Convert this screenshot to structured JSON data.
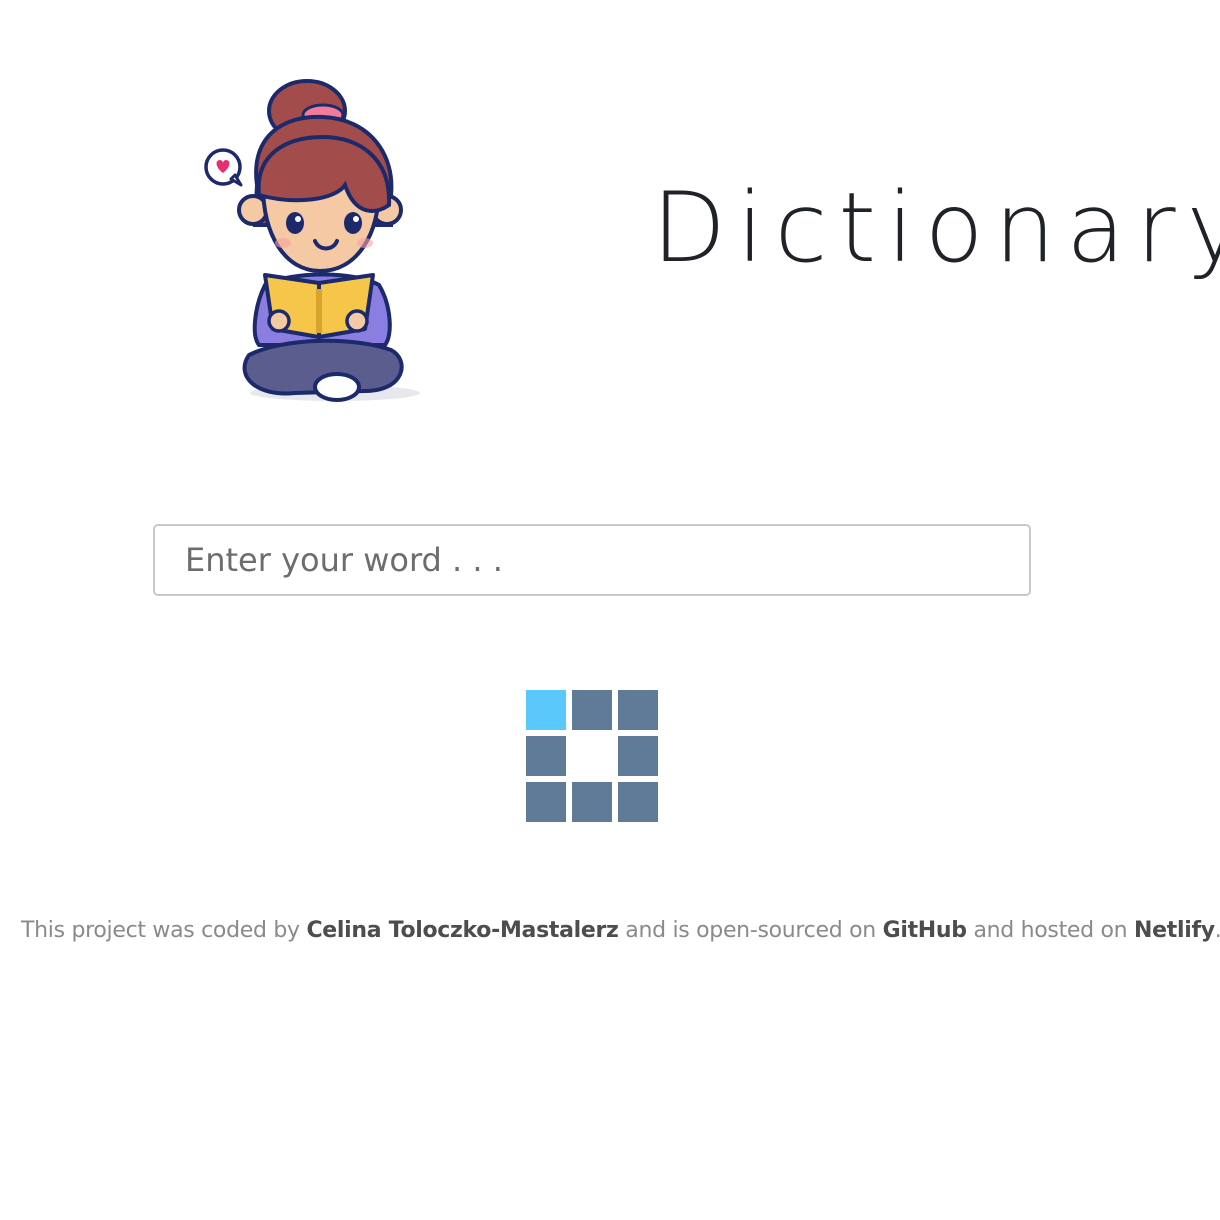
{
  "header": {
    "title": "Dictionary",
    "illustration_name": "girl-reading-book"
  },
  "search": {
    "placeholder": "Enter your word . . .",
    "value": ""
  },
  "loader": {
    "active_color": "#5ac8fa",
    "inactive_color": "#607b98",
    "active_cell": 0
  },
  "footer": {
    "text_1": "This project was coded by",
    "author": "Celina Toloczko-Mastalerz",
    "text_2": "and is open-sourced on",
    "github": "GitHub",
    "text_3": "and hosted on",
    "netlify": "Netlify",
    "text_4": "."
  }
}
